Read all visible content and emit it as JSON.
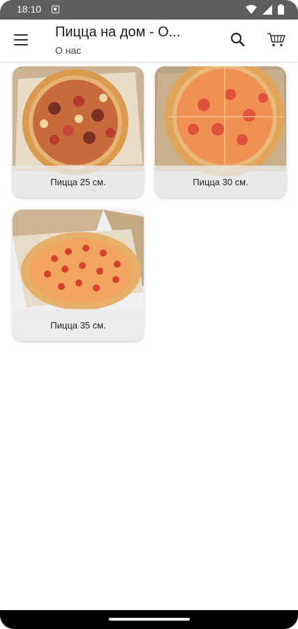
{
  "status_bar": {
    "time": "18:10"
  },
  "app_bar": {
    "title": "Пицца на дом - О...",
    "subtitle": "О нас"
  },
  "products": [
    {
      "label": "Пицца 25 см."
    },
    {
      "label": "Пицца 30 см."
    },
    {
      "label": "Пицца 35 см."
    }
  ]
}
